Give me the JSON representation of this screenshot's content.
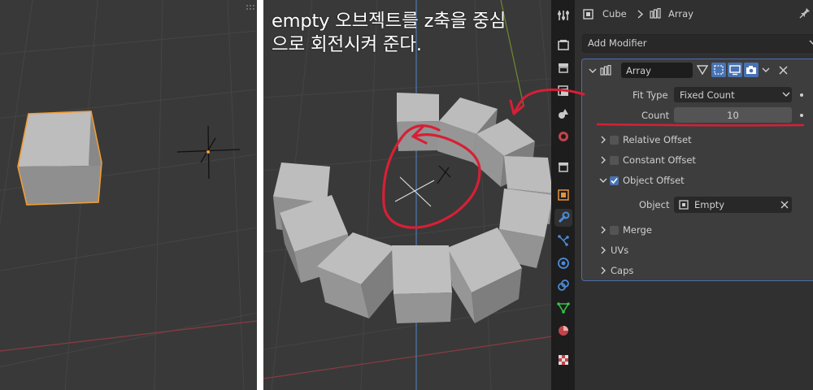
{
  "annotation": {
    "line1": "empty 오브젝트를 z축을 중심",
    "line2": "으로 회전시켜 준다."
  },
  "properties": {
    "breadcrumb": {
      "object": "Cube",
      "modifier": "Array"
    },
    "add_modifier_label": "Add Modifier",
    "modifier": {
      "name": "Array",
      "fit_type_label": "Fit Type",
      "fit_type_value": "Fixed Count",
      "count_label": "Count",
      "count_value": "10",
      "relative_offset_label": "Relative Offset",
      "relative_offset_checked": false,
      "constant_offset_label": "Constant Offset",
      "constant_offset_checked": false,
      "object_offset_label": "Object Offset",
      "object_offset_checked": true,
      "object_label": "Object",
      "object_value": "Empty",
      "merge_label": "Merge",
      "merge_checked": false,
      "uvs_label": "UVs",
      "caps_label": "Caps"
    }
  },
  "tabs": [
    "tool-icon",
    "render-icon",
    "output-icon",
    "view-layer-icon",
    "scene-icon",
    "world-icon",
    "collection-icon",
    "object-icon",
    "modifier-icon",
    "particles-icon",
    "physics-icon",
    "constraints-icon",
    "data-icon",
    "material-icon",
    "texture-icon"
  ],
  "active_tab": "modifier-icon",
  "colors": {
    "viewport_bg": "#393939",
    "panel_bg": "#303030",
    "accent_blue": "#4772b3",
    "selection_orange": "#f19b35",
    "annotation_red": "#d81f35",
    "x_axis": "#8a3b42",
    "y_axis": "#6f8a2e",
    "z_axis": "#4d7bb3"
  }
}
